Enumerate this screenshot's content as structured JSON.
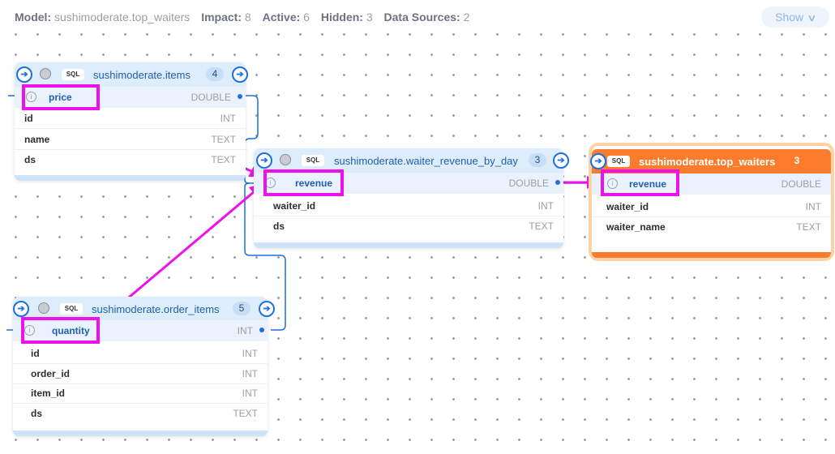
{
  "header": {
    "model_label": "Model:",
    "model_value": "sushimoderate.top_waiters",
    "impact_label": "Impact:",
    "impact_value": "8",
    "active_label": "Active:",
    "active_value": "6",
    "hidden_label": "Hidden:",
    "hidden_value": "3",
    "sources_label": "Data Sources:",
    "sources_value": "2",
    "show_button": "Show"
  },
  "nodes": {
    "items": {
      "badge": "SQL",
      "title": "sushimoderate.items",
      "count": "4",
      "columns": [
        {
          "name": "price",
          "type": "DOUBLE"
        },
        {
          "name": "id",
          "type": "INT"
        },
        {
          "name": "name",
          "type": "TEXT"
        },
        {
          "name": "ds",
          "type": "TEXT"
        }
      ]
    },
    "waiter_revenue": {
      "badge": "SQL",
      "title": "sushimoderate.waiter_revenue_by_day",
      "count": "3",
      "columns": [
        {
          "name": "revenue",
          "type": "DOUBLE"
        },
        {
          "name": "waiter_id",
          "type": "INT"
        },
        {
          "name": "ds",
          "type": "TEXT"
        }
      ]
    },
    "top_waiters": {
      "badge": "SQL",
      "title": "sushimoderate.top_waiters",
      "count": "3",
      "columns": [
        {
          "name": "revenue",
          "type": "DOUBLE"
        },
        {
          "name": "waiter_id",
          "type": "INT"
        },
        {
          "name": "waiter_name",
          "type": "TEXT"
        }
      ]
    },
    "order_items": {
      "badge": "SQL",
      "title": "sushimoderate.order_items",
      "count": "5",
      "columns": [
        {
          "name": "quantity",
          "type": "INT"
        },
        {
          "name": "id",
          "type": "INT"
        },
        {
          "name": "order_id",
          "type": "INT"
        },
        {
          "name": "item_id",
          "type": "INT"
        },
        {
          "name": "ds",
          "type": "TEXT"
        }
      ]
    }
  },
  "icons": {
    "expand": "arrow-right-circle-icon",
    "status": "status-dot-icon",
    "info": "info-icon"
  },
  "colors": {
    "accent": "#1e6fe0",
    "highlight": "#ee11ee",
    "target": "#fb7c2c"
  }
}
